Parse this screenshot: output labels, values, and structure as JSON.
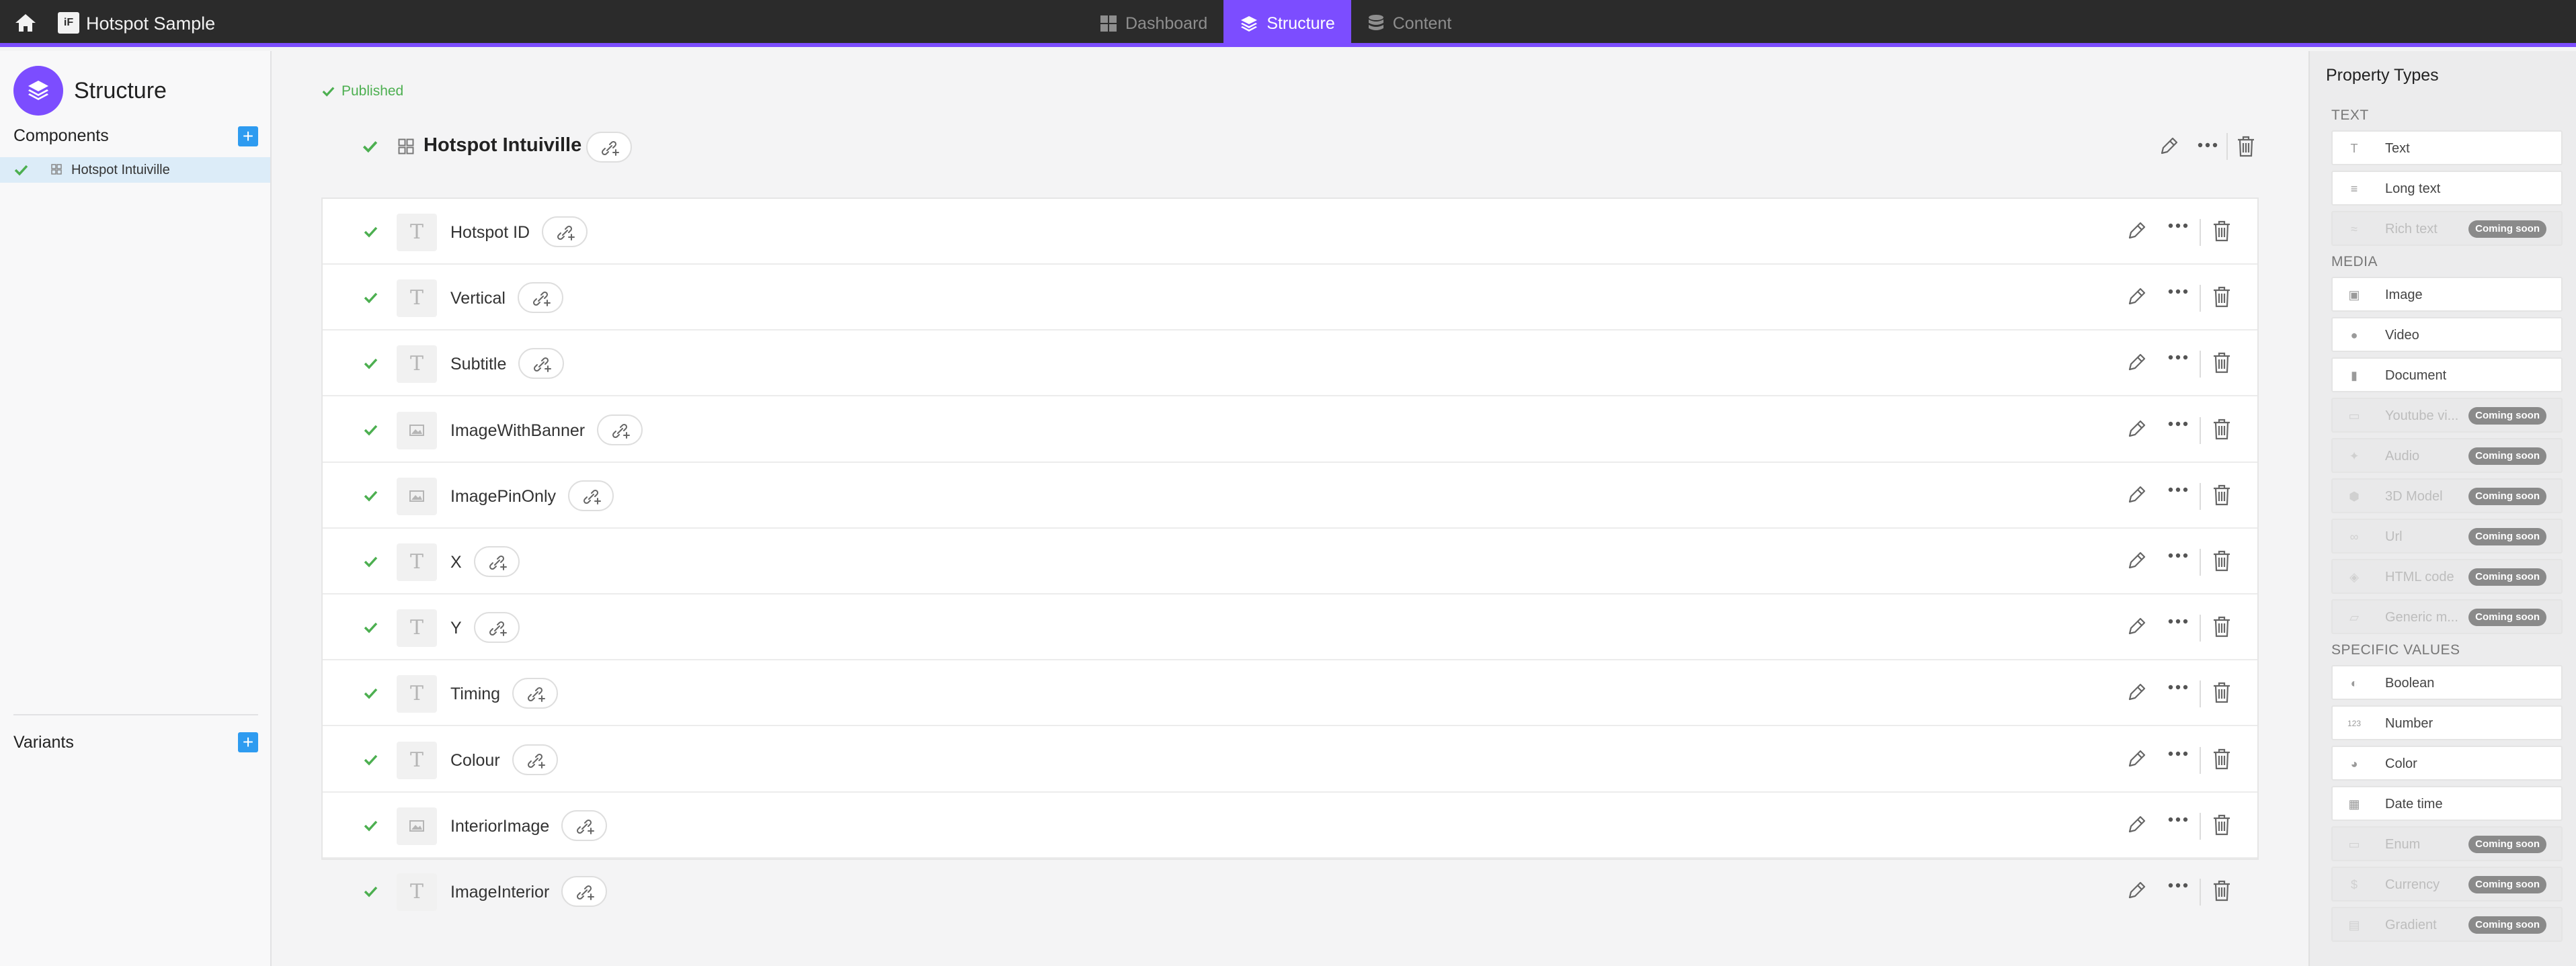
{
  "topbar": {
    "app_logo": "iF",
    "app_name": "Hotspot Sample",
    "tabs": [
      {
        "label": "Dashboard",
        "icon": "dashboard-icon",
        "active": false
      },
      {
        "label": "Structure",
        "icon": "layers-icon",
        "active": true
      },
      {
        "label": "Content",
        "icon": "database-icon",
        "active": false
      }
    ],
    "accent_color": "#7c4dff"
  },
  "sidebar": {
    "title": "Structure",
    "components_label": "Components",
    "components": [
      {
        "label": "Hotspot Intuiville",
        "selected": true,
        "published": true
      }
    ],
    "variants_label": "Variants",
    "add_label": "+"
  },
  "main": {
    "status": "Published",
    "component_title": "Hotspot Intuiville",
    "fields": [
      {
        "label": "Hotspot ID",
        "type": "text"
      },
      {
        "label": "Vertical",
        "type": "text"
      },
      {
        "label": "Subtitle",
        "type": "text"
      },
      {
        "label": "ImageWithBanner",
        "type": "image"
      },
      {
        "label": "ImagePinOnly",
        "type": "image"
      },
      {
        "label": "X",
        "type": "text"
      },
      {
        "label": "Y",
        "type": "text"
      },
      {
        "label": "Timing",
        "type": "text"
      },
      {
        "label": "Colour",
        "type": "text"
      },
      {
        "label": "InteriorImage",
        "type": "image"
      },
      {
        "label": "ImageInterior",
        "type": "text"
      }
    ]
  },
  "property_types": {
    "title": "Property Types",
    "coming_soon": "Coming soon",
    "sections": [
      {
        "label": "TEXT",
        "items": [
          {
            "label": "Text",
            "icon": "text-icon",
            "disabled": false
          },
          {
            "label": "Long text",
            "icon": "long-text-icon",
            "disabled": false
          },
          {
            "label": "Rich text",
            "icon": "rich-text-icon",
            "disabled": true
          }
        ]
      },
      {
        "label": "MEDIA",
        "items": [
          {
            "label": "Image",
            "icon": "image-icon",
            "disabled": false
          },
          {
            "label": "Video",
            "icon": "video-icon",
            "disabled": false
          },
          {
            "label": "Document",
            "icon": "document-icon",
            "disabled": false
          },
          {
            "label": "Youtube vi...",
            "icon": "youtube-icon",
            "disabled": true
          },
          {
            "label": "Audio",
            "icon": "audio-icon",
            "disabled": true
          },
          {
            "label": "3D Model",
            "icon": "cube-icon",
            "disabled": true
          },
          {
            "label": "Url",
            "icon": "link-icon",
            "disabled": true
          },
          {
            "label": "HTML code",
            "icon": "code-icon",
            "disabled": true
          },
          {
            "label": "Generic m...",
            "icon": "folder-icon",
            "disabled": true
          }
        ]
      },
      {
        "label": "SPECIFIC VALUES",
        "items": [
          {
            "label": "Boolean",
            "icon": "toggle-icon",
            "disabled": false
          },
          {
            "label": "Number",
            "icon": "number-icon",
            "disabled": false
          },
          {
            "label": "Color",
            "icon": "palette-icon",
            "disabled": false
          },
          {
            "label": "Date time",
            "icon": "calendar-icon",
            "disabled": false
          },
          {
            "label": "Enum",
            "icon": "enum-icon",
            "disabled": true
          },
          {
            "label": "Currency",
            "icon": "currency-icon",
            "disabled": true
          },
          {
            "label": "Gradient",
            "icon": "gradient-icon",
            "disabled": true
          }
        ]
      }
    ]
  }
}
